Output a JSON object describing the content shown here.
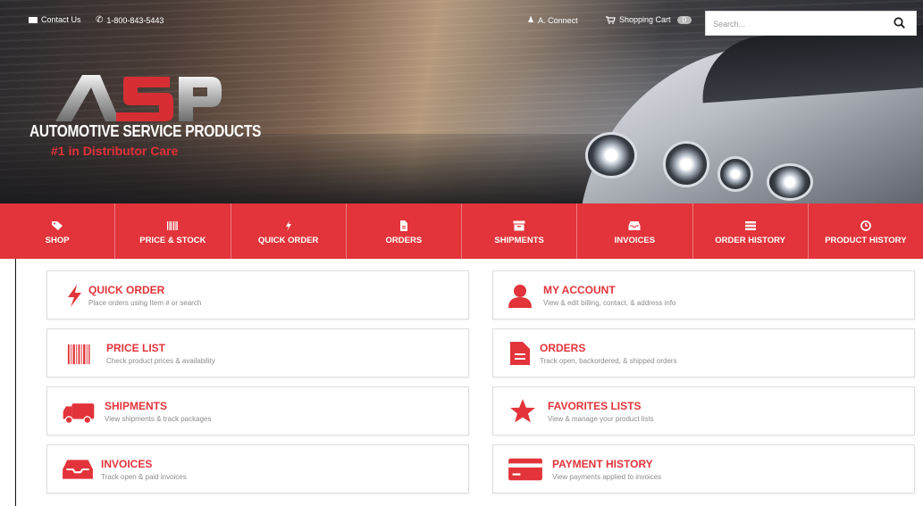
{
  "topbar": {
    "contact": "Contact Us",
    "phone": "1-800-843-5443",
    "user": "A. Connect",
    "cart": "Shopping Cart",
    "cart_count": "0",
    "search_placeholder": "Search..."
  },
  "brand": {
    "logo": "ASP",
    "name": "AUTOMOTIVE SERVICE PRODUCTS",
    "tagline": "#1 in Distributor Care"
  },
  "nav": [
    {
      "label": "SHOP",
      "icon": "tag-icon"
    },
    {
      "label": "PRICE & STOCK",
      "icon": "barcode-icon"
    },
    {
      "label": "QUICK ORDER",
      "icon": "bolt-icon"
    },
    {
      "label": "ORDERS",
      "icon": "file-icon"
    },
    {
      "label": "SHIPMENTS",
      "icon": "archive-icon"
    },
    {
      "label": "INVOICES",
      "icon": "inbox-icon"
    },
    {
      "label": "ORDER HISTORY",
      "icon": "list-icon"
    },
    {
      "label": "PRODUCT HISTORY",
      "icon": "clock-icon"
    }
  ],
  "cards": [
    {
      "title": "QUICK ORDER",
      "desc": "Place orders using Item # or search",
      "icon": "bolt-icon"
    },
    {
      "title": "MY ACCOUNT",
      "desc": "View & edit billing, contact, & address info",
      "icon": "user-icon"
    },
    {
      "title": "PRICE LIST",
      "desc": "Check product prices & availability",
      "icon": "barcode-icon"
    },
    {
      "title": "ORDERS",
      "desc": "Track open, backordered, & shipped orders",
      "icon": "file-icon"
    },
    {
      "title": "SHIPMENTS",
      "desc": "View shipments & track packages",
      "icon": "truck-icon"
    },
    {
      "title": "FAVORITES LISTS",
      "desc": "View & manage your product lists",
      "icon": "star-icon"
    },
    {
      "title": "INVOICES",
      "desc": "Track open & paid invoices",
      "icon": "inbox-icon"
    },
    {
      "title": "PAYMENT HISTORY",
      "desc": "View payments applied to invoices",
      "icon": "credit-card-icon"
    }
  ],
  "colors": {
    "accent": "#e2343a",
    "nav_bg": "#e2343a",
    "card_title": "#e2343a",
    "card_desc": "#8c8c8c"
  }
}
